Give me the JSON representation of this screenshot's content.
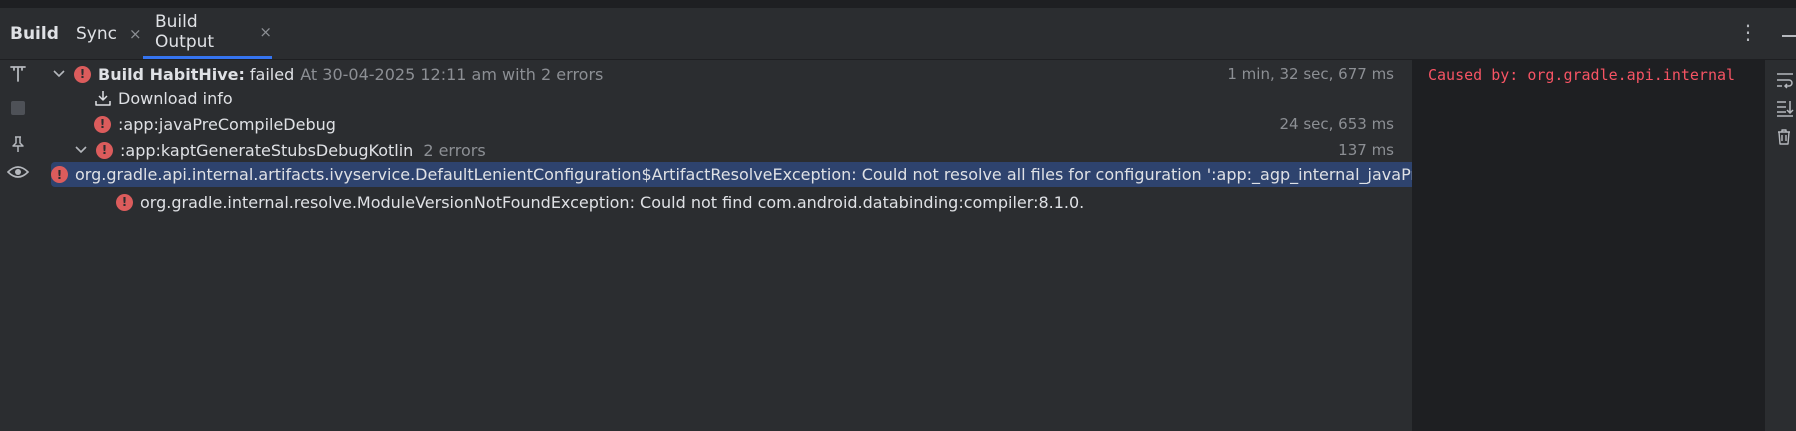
{
  "toolwindow": {
    "title": "Build"
  },
  "tabs": [
    {
      "label": "Sync",
      "close": "×"
    },
    {
      "label": "Build Output",
      "close": "×"
    }
  ],
  "header_actions": {
    "more": "⋮"
  },
  "tree": {
    "root": {
      "name": "Build HabitHive:",
      "status": "failed",
      "detail": "At 30-04-2025 12:11 am with 2 errors",
      "time": "1 min, 32 sec, 677 ms"
    },
    "download": {
      "label": "Download info"
    },
    "task1": {
      "label": ":app:javaPreCompileDebug",
      "time": "24 sec, 653 ms"
    },
    "task2": {
      "label": ":app:kaptGenerateStubsDebugKotlin",
      "count": "2 errors",
      "time": "137 ms"
    },
    "error1": {
      "message": "org.gradle.api.internal.artifacts.ivyservice.DefaultLenientConfiguration$ArtifactResolveException: Could not resolve all files for configuration ':app:_agp_internal_javaPreCompileDebug_kaptClasspath'."
    },
    "error2": {
      "message": "org.gradle.internal.resolve.ModuleVersionNotFoundException: Could not find com.android.databinding:compiler:8.1.0."
    }
  },
  "console": {
    "text": "Caused by: org.gradle.api.internal"
  },
  "icons": {
    "left": [
      "filter-icon",
      "stop-icon",
      "pin-icon",
      "eye-icon"
    ],
    "right": [
      "soft-wrap-icon",
      "scroll-to-end-icon",
      "trash-icon"
    ]
  },
  "colors": {
    "error": "#db5c5c",
    "selection": "#2e436e",
    "accent": "#3574f0",
    "console_error": "#f75464"
  }
}
